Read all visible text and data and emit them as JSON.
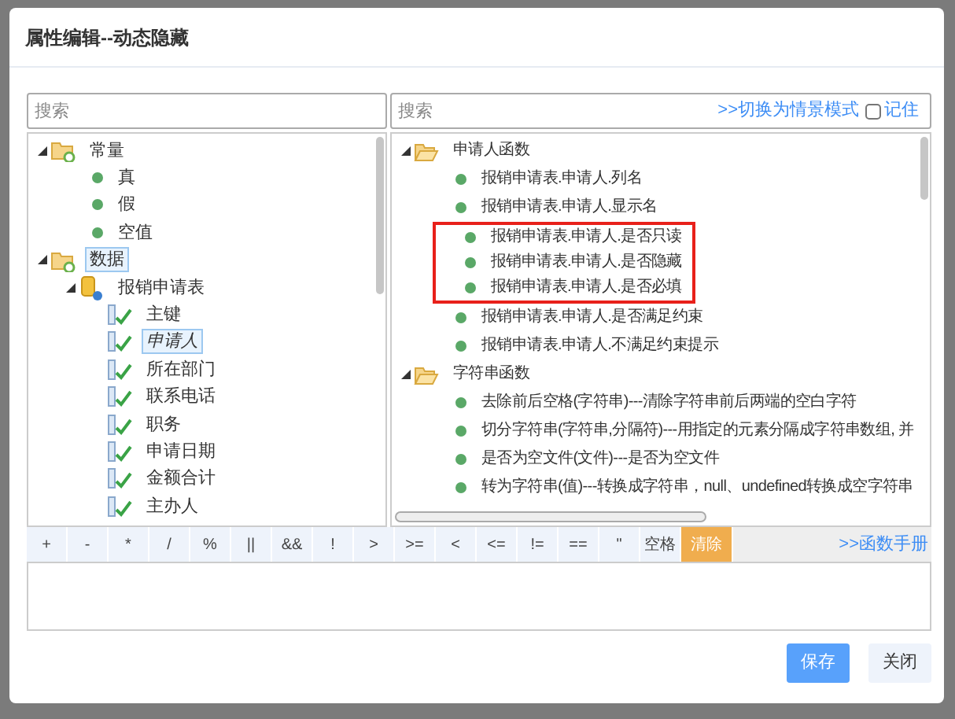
{
  "window": {
    "title": "属性编辑--动态隐藏"
  },
  "left_search": {
    "placeholder": "搜索"
  },
  "right_search": {
    "placeholder": "搜索",
    "mode_link": ">>切换为情景模式",
    "remember": {
      "label": "记住",
      "checked": false
    }
  },
  "left_tree": [
    {
      "label": "常量",
      "kind": "folder",
      "expanded": true,
      "selected": false,
      "children": [
        {
          "label": "真",
          "kind": "leaf",
          "selected": false
        },
        {
          "label": "假",
          "kind": "leaf",
          "selected": false
        },
        {
          "label": "空值",
          "kind": "leaf",
          "selected": false
        }
      ]
    },
    {
      "label": "数据",
      "kind": "folder",
      "expanded": true,
      "selected": true,
      "children": [
        {
          "label": "报销申请表",
          "kind": "table",
          "expanded": true,
          "selected": false,
          "children": [
            {
              "label": "主键",
              "kind": "field",
              "selected": false
            },
            {
              "label": "申请人",
              "kind": "field",
              "selected": true
            },
            {
              "label": "所在部门",
              "kind": "field",
              "selected": false
            },
            {
              "label": "联系电话",
              "kind": "field",
              "selected": false
            },
            {
              "label": "职务",
              "kind": "field",
              "selected": false
            },
            {
              "label": "申请日期",
              "kind": "field",
              "selected": false
            },
            {
              "label": "金额合计",
              "kind": "field",
              "selected": false
            },
            {
              "label": "主办人",
              "kind": "field",
              "selected": false
            }
          ]
        }
      ]
    }
  ],
  "right_tree": [
    {
      "label": "申请人函数",
      "kind": "open-folder",
      "expanded": true,
      "children": [
        {
          "label": "报销申请表.申请人.列名",
          "kind": "leaf",
          "highlighted": false
        },
        {
          "label": "报销申请表.申请人.显示名",
          "kind": "leaf",
          "highlighted": false
        },
        {
          "label": "报销申请表.申请人.是否只读",
          "kind": "leaf",
          "highlighted": true
        },
        {
          "label": "报销申请表.申请人.是否隐藏",
          "kind": "leaf",
          "highlighted": true
        },
        {
          "label": "报销申请表.申请人.是否必填",
          "kind": "leaf",
          "highlighted": true
        },
        {
          "label": "报销申请表.申请人.是否满足约束",
          "kind": "leaf",
          "highlighted": false
        },
        {
          "label": "报销申请表.申请人.不满足约束提示",
          "kind": "leaf",
          "highlighted": false
        }
      ]
    },
    {
      "label": "字符串函数",
      "kind": "open-folder",
      "expanded": true,
      "children": [
        {
          "label": "去除前后空格(字符串)---清除字符串前后两端的空白字符",
          "kind": "leaf",
          "highlighted": false
        },
        {
          "label": "切分字符串(字符串,分隔符)---用指定的元素分隔成字符串数组, 并",
          "kind": "leaf",
          "highlighted": false
        },
        {
          "label": "是否为空文件(文件)---是否为空文件",
          "kind": "leaf",
          "highlighted": false
        },
        {
          "label": "转为字符串(值)---转换成字符串，null、undefined转换成空字符串",
          "kind": "leaf",
          "highlighted": false
        }
      ]
    }
  ],
  "operators": [
    {
      "label": "+",
      "kind": "operator"
    },
    {
      "label": "-",
      "kind": "operator"
    },
    {
      "label": "*",
      "kind": "operator"
    },
    {
      "label": "/",
      "kind": "operator"
    },
    {
      "label": "%",
      "kind": "operator"
    },
    {
      "label": "||",
      "kind": "operator"
    },
    {
      "label": "&&",
      "kind": "operator"
    },
    {
      "label": "!",
      "kind": "operator"
    },
    {
      "label": ">",
      "kind": "operator"
    },
    {
      "label": ">=",
      "kind": "operator"
    },
    {
      "label": "<",
      "kind": "operator"
    },
    {
      "label": "<=",
      "kind": "operator"
    },
    {
      "label": "!=",
      "kind": "operator"
    },
    {
      "label": "==",
      "kind": "operator"
    },
    {
      "label": "\"",
      "kind": "operator"
    },
    {
      "label": "空格",
      "kind": "operator"
    },
    {
      "label": "清除",
      "kind": "clear"
    }
  ],
  "manual_link": ">>函数手册",
  "buttons": [
    {
      "label": "保存",
      "kind": "primary"
    },
    {
      "label": "关闭",
      "kind": "secondary"
    }
  ]
}
